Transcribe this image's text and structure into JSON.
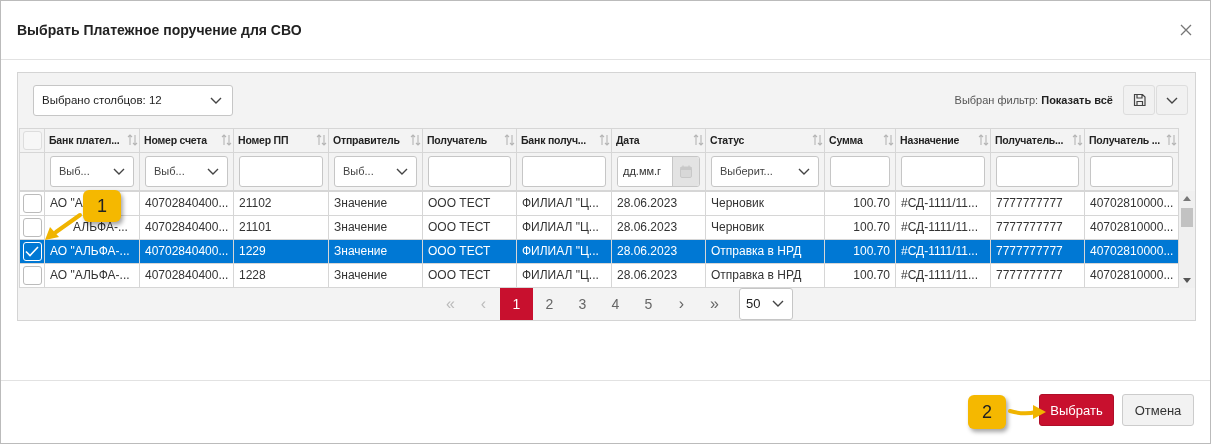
{
  "dialog": {
    "title": "Выбрать Платежное поручение для СВО"
  },
  "toolbar": {
    "columns_select": "Выбрано столбцов: 12",
    "filter_text": "Выбран фильтр: **Показать всё**"
  },
  "table": {
    "select_all": {
      "checked": false
    },
    "columns": [
      {
        "title": "Банк плател...",
        "filter": {
          "kind": "select",
          "value": "Выб..."
        }
      },
      {
        "title": "Номер счета",
        "filter": {
          "kind": "select",
          "value": "Выб..."
        }
      },
      {
        "title": "Номер ПП",
        "filter": {
          "kind": "text"
        }
      },
      {
        "title": "Отправитель",
        "filter": {
          "kind": "select",
          "value": "Выб..."
        }
      },
      {
        "title": "Получатель",
        "filter": {
          "kind": "text"
        }
      },
      {
        "title": "Банк получ...",
        "filter": {
          "kind": "text"
        }
      },
      {
        "title": "Дата",
        "filter": {
          "kind": "date",
          "placeholder": "дд.мм.г"
        }
      },
      {
        "title": "Статус",
        "filter": {
          "kind": "select",
          "value": "Выберит..."
        }
      },
      {
        "title": "Сумма",
        "filter": {
          "kind": "text"
        }
      },
      {
        "title": "Назначение",
        "filter": {
          "kind": "text"
        }
      },
      {
        "title": "Получатель...",
        "filter": {
          "kind": "text"
        }
      },
      {
        "title": "Получатель ...",
        "filter": {
          "kind": "text"
        }
      }
    ],
    "rows": [
      {
        "selected": false,
        "checked": false,
        "cells": [
          "АО \"А",
          "40702840400...",
          "21102",
          "Значение",
          "ООО ТЕСТ",
          "ФИЛИАЛ \"Ц...",
          "28.06.2023",
          "Черновик",
          "100.70",
          "#СД-1111/11...",
          "7777777777",
          "40702810000..."
        ]
      },
      {
        "selected": false,
        "checked": false,
        "cells": [
          "АЛЬФА-...",
          "40702840400...",
          "21101",
          "Значение",
          "ООО ТЕСТ",
          "ФИЛИАЛ \"Ц...",
          "28.06.2023",
          "Черновик",
          "100.70",
          "#СД-1111/11...",
          "7777777777",
          "40702810000..."
        ]
      },
      {
        "selected": true,
        "checked": true,
        "cells": [
          "АО \"АЛЬФА-...",
          "40702840400...",
          "1229",
          "Значение",
          "ООО ТЕСТ",
          "ФИЛИАЛ \"Ц...",
          "28.06.2023",
          "Отправка в НРД",
          "100.70",
          "#СД-1111/11...",
          "7777777777",
          "40702810000..."
        ]
      },
      {
        "selected": false,
        "checked": false,
        "cells": [
          "АО \"АЛЬФА-...",
          "40702840400...",
          "1228",
          "Значение",
          "ООО ТЕСТ",
          "ФИЛИАЛ \"Ц...",
          "28.06.2023",
          "Отправка в НРД",
          "100.70",
          "#СД-1111/11...",
          "7777777777",
          "40702810000..."
        ]
      }
    ]
  },
  "pagination": {
    "first": {
      "label": "«",
      "disabled": true
    },
    "prev": {
      "label": "‹",
      "disabled": true
    },
    "pages": [
      {
        "label": "1",
        "selected": true
      },
      {
        "label": "2",
        "selected": false
      },
      {
        "label": "3",
        "selected": false
      },
      {
        "label": "4",
        "selected": false
      },
      {
        "label": "5",
        "selected": false
      }
    ],
    "next": {
      "label": "›",
      "disabled": false
    },
    "last": {
      "label": "»",
      "disabled": false
    },
    "page_size": "50"
  },
  "buttons": [
    {
      "label": "Выбрать",
      "kind": "primary"
    },
    {
      "label": "Отмена",
      "kind": "secondary"
    }
  ],
  "callouts": [
    {
      "label": "1"
    },
    {
      "label": "2"
    }
  ]
}
